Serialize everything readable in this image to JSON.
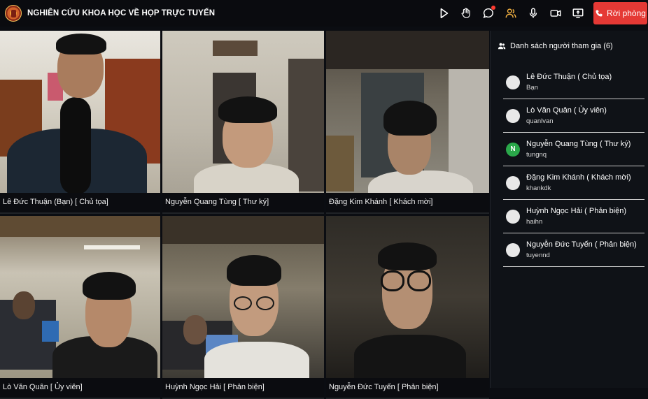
{
  "app": {
    "title": "NGHIÊN CỨU KHOA HỌC VỀ HỌP TRỰC TUYẾN"
  },
  "toolbar": {
    "icons": [
      "play-icon",
      "raise-hand-icon",
      "chat-icon",
      "participants-icon",
      "microphone-icon",
      "camera-icon",
      "screen-share-icon"
    ],
    "leave_label": "Rời phòng",
    "accent_color": "#e53935",
    "active_icon_color": "#f5b342"
  },
  "tiles": [
    {
      "label": "Lê Đức Thuận (Bạn) [ Chủ tọa]"
    },
    {
      "label": "Nguyễn Quang Tùng [ Thư ký]"
    },
    {
      "label": "Đặng Kim Khánh  [ Khách mời]"
    },
    {
      "label": "Lò Văn Quân [ Ủy viên]"
    },
    {
      "label": "Huỳnh Ngọc Hải [ Phản biện]"
    },
    {
      "label": "Nguyễn Đức Tuyến [ Phản biện]"
    }
  ],
  "participants": {
    "title": "Danh sách người tham gia (6)",
    "items": [
      {
        "name": "Lê Đức Thuận ( Chủ tọa)",
        "username": "Bạn",
        "avatar": ""
      },
      {
        "name": "Lò Văn Quân ( Ủy viên)",
        "username": "quanlvan",
        "avatar": ""
      },
      {
        "name": "Nguyễn Quang Tùng ( Thư ký)",
        "username": "tungnq",
        "avatar": "N"
      },
      {
        "name": "Đặng Kim Khánh ( Khách mời)",
        "username": "khankdk",
        "avatar": ""
      },
      {
        "name": "Huỳnh Ngọc Hải ( Phản biện)",
        "username": "haihn",
        "avatar": ""
      },
      {
        "name": "Nguyễn Đức Tuyến ( Phản biện)",
        "username": "tuyennd",
        "avatar": ""
      }
    ]
  }
}
